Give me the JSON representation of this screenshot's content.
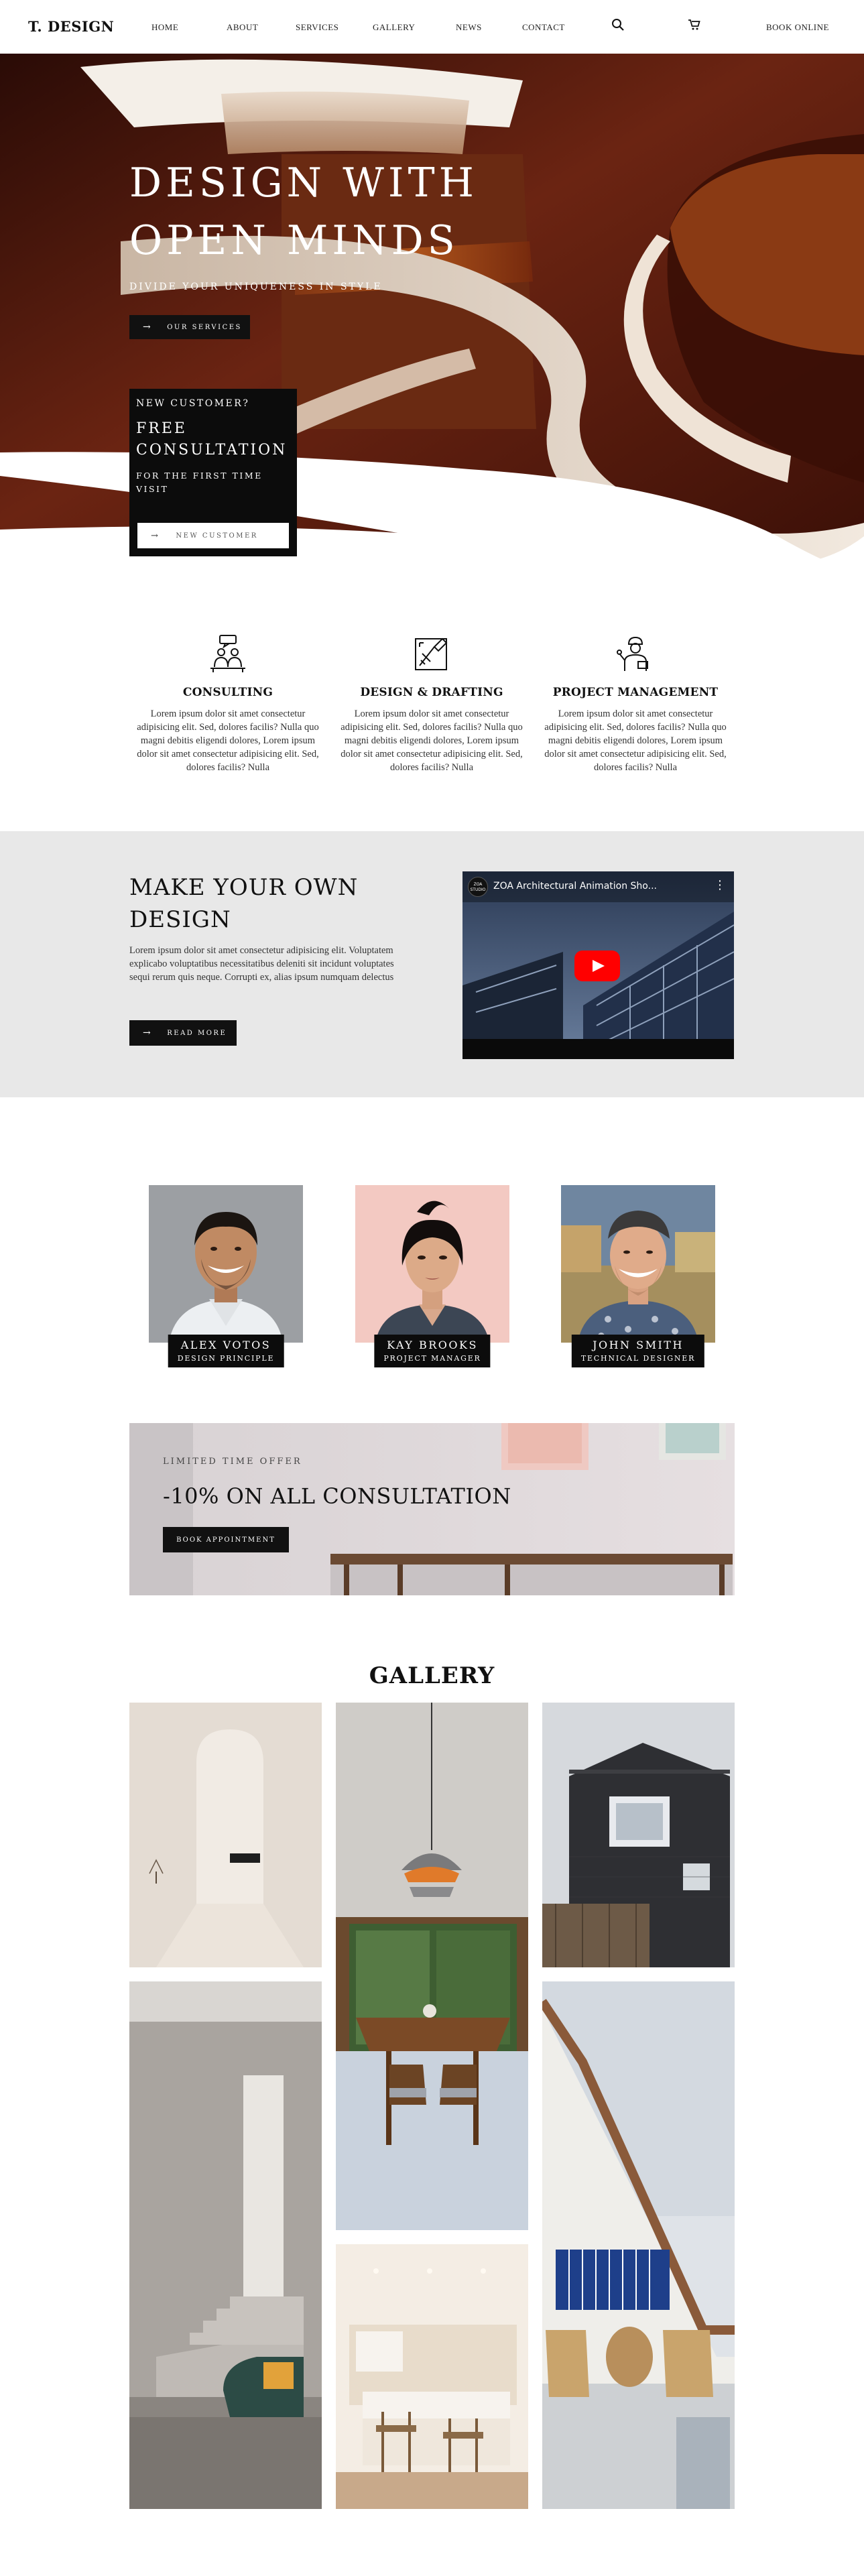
{
  "nav": {
    "logo": "T. DESIGN",
    "links": [
      "HOME",
      "ABOUT",
      "SERVICES",
      "GALLERY",
      "NEWS",
      "CONTACT"
    ],
    "book": "BOOK ONLINE"
  },
  "hero": {
    "title": "DESIGN WITH\nOPEN MINDS",
    "subtitle": "DIVIDE YOUR UNIQUENESS IN STYLE",
    "cta": "OUR SERVICES",
    "card": {
      "question": "NEW CUSTOMER?",
      "headline": "FREE\nCONSULTATION",
      "note": "FOR THE FIRST TIME\nVISIT",
      "button": "NEW CUSTOMER"
    }
  },
  "services": [
    {
      "title": "CONSULTING",
      "text": "Lorem ipsum dolor sit amet consectetur adipisicing elit. Sed, dolores facilis? Nulla quo magni debitis eligendi dolores, Lorem ipsum dolor sit amet consectetur adipisicing elit. Sed, dolores facilis? Nulla"
    },
    {
      "title": "DESIGN & DRAFTING",
      "text": "Lorem ipsum dolor sit amet consectetur adipisicing elit. Sed, dolores facilis? Nulla quo magni debitis eligendi dolores, Lorem ipsum dolor sit amet consectetur adipisicing elit. Sed, dolores facilis? Nulla"
    },
    {
      "title": "PROJECT MANAGEMENT",
      "text": "Lorem ipsum dolor sit amet consectetur adipisicing elit. Sed, dolores facilis? Nulla quo magni debitis eligendi dolores, Lorem ipsum dolor sit amet consectetur adipisicing elit. Sed, dolores facilis? Nulla"
    }
  ],
  "about": {
    "title": "MAKE YOUR OWN\nDESIGN",
    "text": "Lorem ipsum dolor sit amet consectetur adipisicing elit. Voluptatem explicabo voluptatibus necessitatibus deleniti sit incidunt voluptates sequi rerum quis neque. Corrupti ex, alias ipsum numquam delectus",
    "button": "READ MORE",
    "video_title": "ZOA Architectural Animation Sho...",
    "channel": "ZOA STUDIO"
  },
  "team": [
    {
      "name": "ALEX VOTOS",
      "role": "DESIGN PRINCIPLE"
    },
    {
      "name": "KAY BROOKS",
      "role": "PROJECT MANAGER"
    },
    {
      "name": "JOHN SMITH",
      "role": "TECHNICAL DESIGNER"
    }
  ],
  "offer": {
    "label": "LIMITED TIME OFFER",
    "title": "-10% ON ALL CONSULTATION",
    "button": "BOOK APPOINTMENT"
  },
  "gallery": {
    "title": "GALLERY"
  },
  "colors": {
    "accent": "#111111",
    "band": "#e8e8e8",
    "youtube_red": "#ff0000"
  }
}
